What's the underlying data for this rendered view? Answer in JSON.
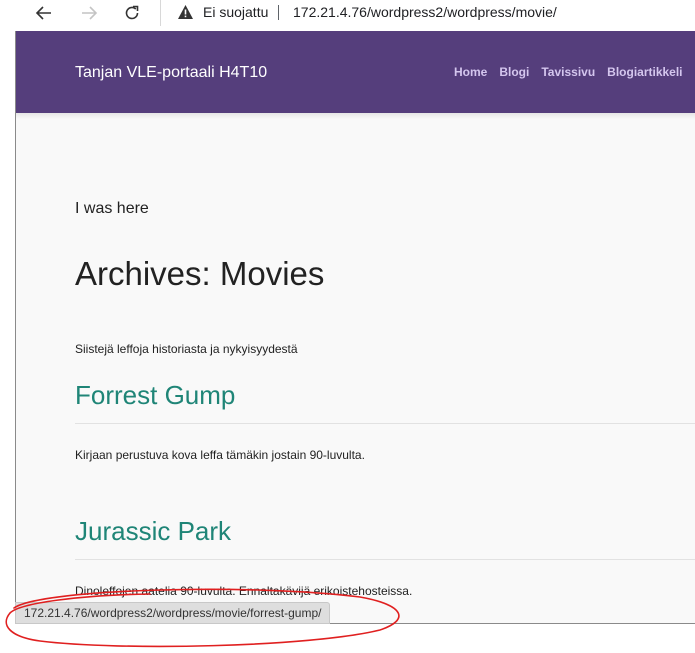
{
  "browser": {
    "back_icon": "arrow-left-icon",
    "forward_icon": "arrow-right-icon",
    "reload_icon": "reload-icon",
    "security_icon": "warning-triangle-icon",
    "security_label": "Ei suojattu",
    "url": "172.21.4.76/wordpress2/wordpress/movie/",
    "status_url": "172.21.4.76/wordpress2/wordpress/movie/forrest-gump/"
  },
  "site": {
    "title": "Tanjan VLE-portaali H4T10",
    "header_color": "#553e7c",
    "nav": [
      {
        "label": "Home"
      },
      {
        "label": "Blogi"
      },
      {
        "label": "Tavissivu"
      },
      {
        "label": "Blogiartikkeli"
      }
    ]
  },
  "main": {
    "note": "I was here",
    "archive_title": "Archives: Movies",
    "archive_description": "Siistejä leffoja historiasta ja nykyisyydestä",
    "posts": [
      {
        "title": "Forrest Gump",
        "excerpt": "Kirjaan perustuva kova leffa tämäkin jostain 90-luvulta."
      },
      {
        "title": "Jurassic Park",
        "excerpt": "Dinoleffojen aatelia 90-luvulta. Ennaltakävijä erikoistehosteissa."
      }
    ],
    "link_color": "#1f8577"
  },
  "annotation": {
    "shape": "hand-drawn-ellipse",
    "color": "#e02020"
  }
}
